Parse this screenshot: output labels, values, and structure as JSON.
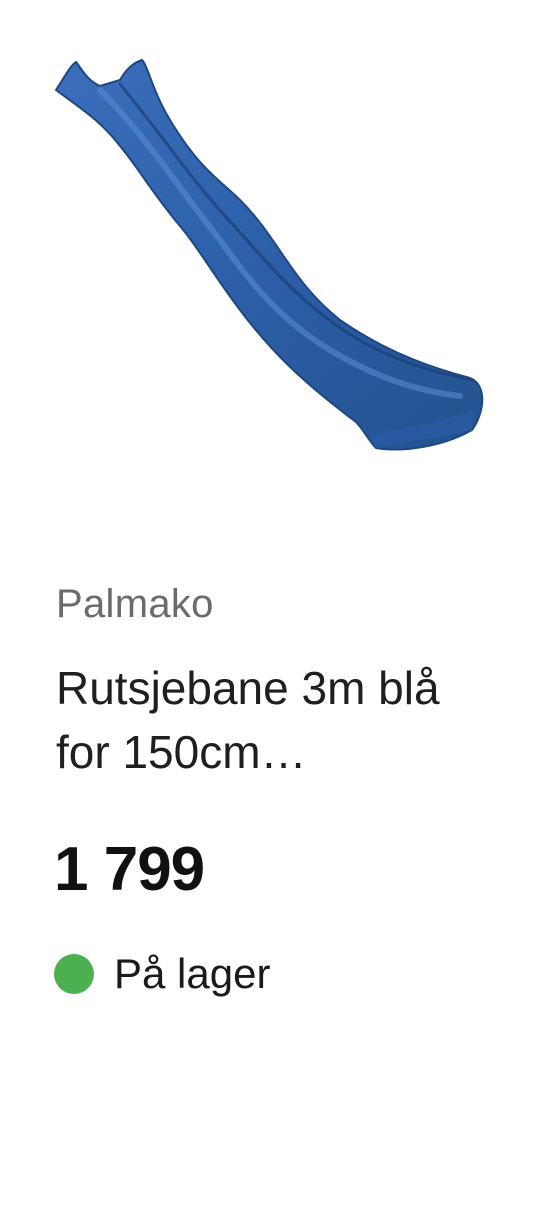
{
  "product": {
    "image_name": "blue-slide-product-image",
    "brand": "Palmako",
    "title": "Rutsjebane 3m blå for 150cm…",
    "price": "1 799",
    "stock": {
      "label": "På lager",
      "status_color": "#4CAF50"
    },
    "colors": {
      "slide_main": "#2C5FA8",
      "slide_dark": "#1F4784",
      "slide_light": "#4A7FC9"
    }
  }
}
